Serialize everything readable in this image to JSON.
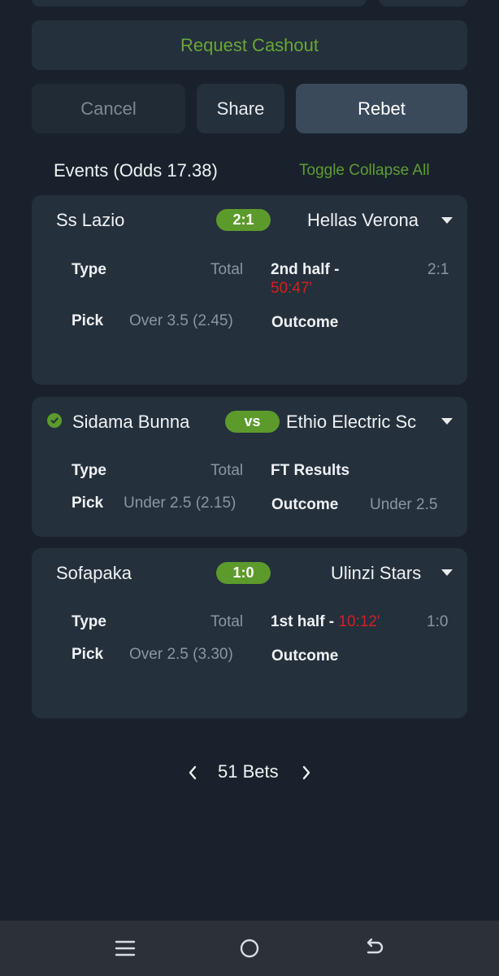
{
  "actions": {
    "request_cashout": "Request Cashout",
    "cancel": "Cancel",
    "share": "Share",
    "rebet": "Rebet"
  },
  "events_header": {
    "title": "Events (Odds 17.38)",
    "toggle": "Toggle Collapse All"
  },
  "events": [
    {
      "home": "Ss Lazio",
      "score": "2:1",
      "away": "Hellas Verona",
      "type_label": "Type",
      "type_value": "Total",
      "status_prefix": "2nd half -",
      "status_time": "50:47'",
      "status_score": "2:1",
      "pick_label": "Pick",
      "pick_value": "Over 3.5 (2.45)",
      "outcome_label": "Outcome",
      "outcome_value": ""
    },
    {
      "home": "Sidama Bunna",
      "score": "vs",
      "away": "Ethio Electric Sc",
      "type_label": "Type",
      "type_value": "Total",
      "status_prefix": "FT Results",
      "pick_label": "Pick",
      "pick_value": "Under 2.5 (2.15)",
      "outcome_label": "Outcome",
      "outcome_value": "Under 2.5"
    },
    {
      "home": "Sofapaka",
      "score": "1:0",
      "away": "Ulinzi Stars",
      "type_label": "Type",
      "type_value": "Total",
      "status_prefix": "1st half -",
      "status_time": "10:12'",
      "status_score": "1:0",
      "pick_label": "Pick",
      "pick_value": "Over 2.5 (3.30)",
      "outcome_label": "Outcome",
      "outcome_value": ""
    }
  ],
  "pager": {
    "label": "51 Bets"
  },
  "colors": {
    "background": "#19222c",
    "card": "#24303c",
    "accent_green": "#5c9a2c",
    "live_red": "#d42020"
  },
  "icons": {
    "won_check": "check-circle-icon",
    "expand": "chevron-down-icon",
    "prev": "chevron-left-icon",
    "next": "chevron-right-icon",
    "nav_menu": "menu-icon",
    "nav_home": "home-circle-icon",
    "nav_back": "back-icon"
  }
}
